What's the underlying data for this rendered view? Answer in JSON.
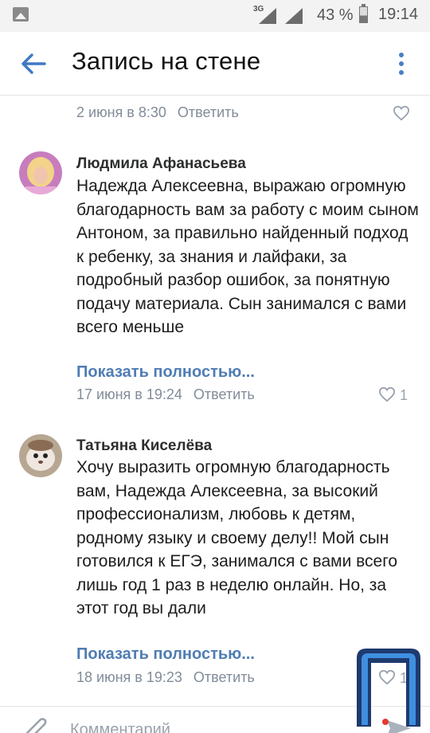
{
  "status_bar": {
    "network": "3G",
    "battery": "43 %",
    "time": "19:14"
  },
  "header": {
    "title": "Запись на стене"
  },
  "previous_comment": {
    "date": "2 июня в 8:30",
    "reply_label": "Ответить"
  },
  "comments": [
    {
      "author": "Людмила Афанасьева",
      "text": "Надежда Алексеевна, выражаю огромную благодарность вам за работу с моим сыном Антоном, за правильно найденный подход к ребенку, за знания и лайфаки, за подробный разбор ошибок, за понятную подачу материала. Сын занимался с вами всего меньше",
      "more_label": "Показать полностью...",
      "date": "17 июня в 19:24",
      "reply_label": "Ответить",
      "likes": "1"
    },
    {
      "author": "Татьяна Киселёва",
      "text": "Хочу выразить огромную благодарность вам, Надежда Алексеевна, за высокий профессионализм, любовь к детям, родному языку и своему делу!! Мой сын готовился к ЕГЭ, занимался с вами всего лишь год 1 раз в неделю онлайн. Но, за этот год вы дали",
      "more_label": "Показать полностью...",
      "date": "18 июня в 19:23",
      "reply_label": "Ответить",
      "likes": "1"
    }
  ],
  "composer": {
    "placeholder": "Комментарий"
  },
  "colors": {
    "accent": "#4f7db3",
    "secondary_text": "#818c99"
  }
}
